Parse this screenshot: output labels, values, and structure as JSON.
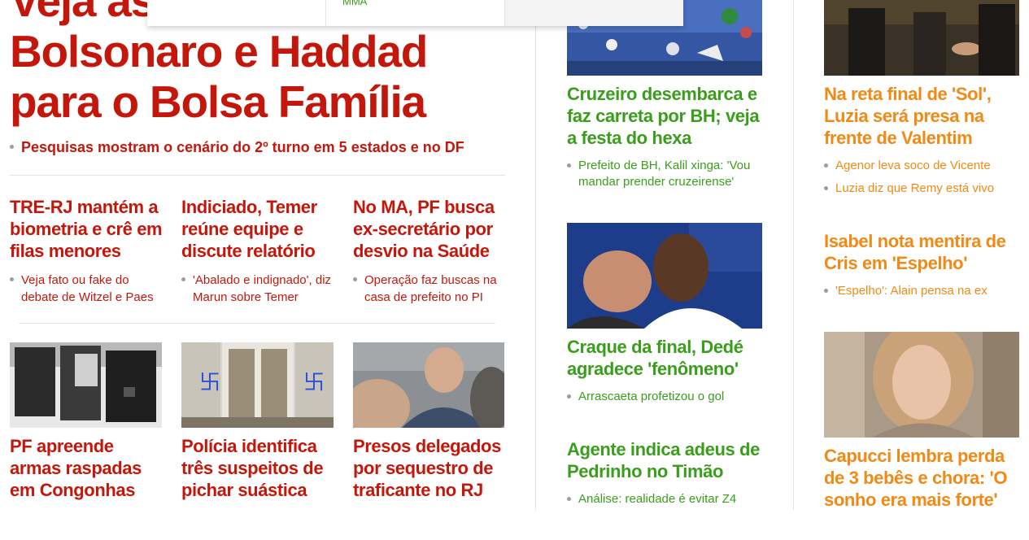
{
  "main_story": {
    "headline": "Veja as propostas de Bolsonaro e Haddad para o Bolsa Família",
    "related": "Pesquisas mostram o cenário do 2º turno em 5 estados e no DF"
  },
  "text_stories": [
    {
      "title": "TRE-RJ mantém a biometria e crê em filas menores",
      "related": "Veja fato ou fake do debate de Witzel e Paes"
    },
    {
      "title": "Indiciado, Temer reúne equipe e discute relatório",
      "related": "'Abalado e indignado', diz Marun sobre Temer"
    },
    {
      "title": "No MA, PF busca ex-secretário por desvio na Saúde",
      "related": "Operação faz buscas na casa de prefeito no PI"
    }
  ],
  "photo_stories": [
    {
      "title": "PF apreende armas raspadas em Congonhas",
      "image": "seized-firearms-photo"
    },
    {
      "title": "Polícia identifica três suspeitos de pichar suástica",
      "image": "swastika-graffiti-door-photo"
    },
    {
      "title": "Presos delegados por sequestro de traficante no RJ",
      "image": "arrested-man-photo"
    }
  ],
  "sports": [
    {
      "title": "Cruzeiro desembarca e faz carreta por BH; veja a festa do hexa",
      "related": [
        "Prefeito de BH, Kalil xinga: 'Vou mandar prender cruzeirense'"
      ],
      "image": "crowd-celebration-photo"
    },
    {
      "title": "Craque da final, Dedé agradece 'fenômeno'",
      "related": [
        "Arrascaeta profetizou o gol"
      ],
      "image": "players-embrace-photo"
    },
    {
      "title": "Agente indica adeus de Pedrinho no Timão",
      "related": [
        "Análise: realidade é evitar Z4"
      ]
    }
  ],
  "entertainment": [
    {
      "title": "Na reta final de 'Sol', Luzia será presa na frente de Valentim",
      "related": [
        "Agenor leva soco de Vicente",
        "Luzia diz que Remy está vivo"
      ],
      "image": "telenovela-scene-photo"
    },
    {
      "title": "Isabel nota mentira de Cris em 'Espelho'",
      "related": [
        "'Espelho': Alain pensa na ex"
      ]
    },
    {
      "title": "Capucci lembra perda de 3 bebês e chora: 'O sonho era mais forte'",
      "related": [],
      "image": "woman-crying-photo"
    }
  ],
  "dropdown": {
    "visible_link": "MMA"
  },
  "colors": {
    "news": "#c4170c",
    "sports": "#3a9e1c",
    "entertainment": "#f08a15",
    "divider": "#e3e3e3"
  }
}
